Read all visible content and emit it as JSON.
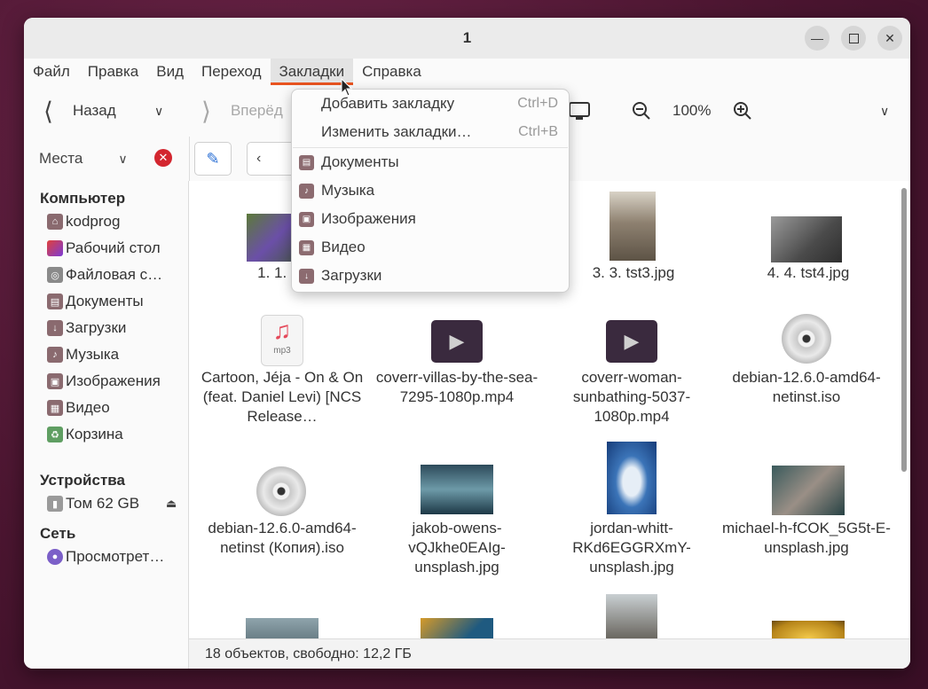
{
  "window": {
    "title": "1"
  },
  "menubar": [
    "Файл",
    "Правка",
    "Вид",
    "Переход",
    "Закладки",
    "Справка"
  ],
  "toolbar": {
    "back": "Назад",
    "forward": "Вперёд",
    "zoom": "100%"
  },
  "sidebar": {
    "places_label": "Места",
    "sections": {
      "computer": "Компьютер",
      "devices": "Устройства",
      "network": "Сеть"
    },
    "items": [
      {
        "label": "kodprog",
        "icon": "home-icon"
      },
      {
        "label": "Рабочий стол",
        "icon": "desktop-icon"
      },
      {
        "label": "Файловая с…",
        "icon": "filesystem-icon"
      },
      {
        "label": "Документы",
        "icon": "documents-icon"
      },
      {
        "label": "Загрузки",
        "icon": "downloads-icon"
      },
      {
        "label": "Музыка",
        "icon": "music-icon"
      },
      {
        "label": "Изображения",
        "icon": "pictures-icon"
      },
      {
        "label": "Видео",
        "icon": "videos-icon"
      },
      {
        "label": "Корзина",
        "icon": "trash-icon"
      }
    ],
    "devices": [
      {
        "label": "Том 62 GB",
        "icon": "drive-icon"
      }
    ],
    "network": [
      {
        "label": "Просмотрет…",
        "icon": "network-icon"
      }
    ]
  },
  "bookmarks_menu": {
    "add": {
      "label": "Добавить закладку",
      "accel": "Ctrl+D"
    },
    "edit": {
      "label": "Изменить закладки…",
      "accel": "Ctrl+B"
    },
    "items": [
      "Документы",
      "Музыка",
      "Изображения",
      "Видео",
      "Загрузки"
    ]
  },
  "files": [
    {
      "name": "1. 1. tst",
      "type": "image"
    },
    {
      "name": "3. 3. tst3.jpg",
      "type": "image"
    },
    {
      "name": "4. 4. tst4.jpg",
      "type": "image"
    },
    {
      "name": "Cartoon, Jéja - On & On (feat. Daniel Levi) [NCS Release…",
      "type": "audio",
      "badge": "mp3"
    },
    {
      "name": "coverr-villas-by-the-sea-7295-1080p.mp4",
      "type": "video"
    },
    {
      "name": "coverr-woman-sunbathing-5037-1080p.mp4",
      "type": "video"
    },
    {
      "name": "debian-12.6.0-amd64-netinst.iso",
      "type": "disc"
    },
    {
      "name": "debian-12.6.0-amd64-netinst (Копия).iso",
      "type": "disc"
    },
    {
      "name": "jakob-owens-vQJkhe0EAIg-unsplash.jpg",
      "type": "image"
    },
    {
      "name": "jordan-whitt-RKd6EGGRXmY-unsplash.jpg",
      "type": "image"
    },
    {
      "name": "michael-h-fCOK_5G5t-E-unsplash.jpg",
      "type": "image"
    }
  ],
  "status": "18 объектов, свободно: 12,2 ГБ",
  "colors": {
    "accent": "#e95420",
    "folder_icon": "#8a6a6f"
  }
}
